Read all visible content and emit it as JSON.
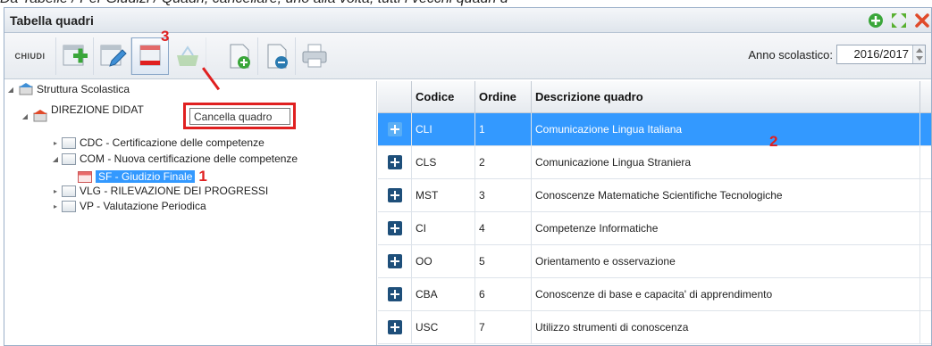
{
  "top_strip": "Da Tabelle / Per Giudizi / Quadri, cancellare, uno alla volta, tutti i vecchi quadri d",
  "window": {
    "title": "Tabella quadri"
  },
  "title_icons": [
    "add-circle-icon",
    "maximize-icon",
    "close-icon"
  ],
  "toolbar": {
    "close_label": "CHIUDI",
    "buttons": [
      "add-quadro-icon",
      "edit-quadro-icon",
      "delete-quadro-icon",
      "basket-icon",
      "add-document-icon",
      "document-settings-icon",
      "print-icon"
    ],
    "annotation": "3",
    "year_label": "Anno scolastico:",
    "year_value": "2016/2017"
  },
  "tooltip": "Cancella quadro",
  "tree": {
    "root": "Struttura Scolastica",
    "school": "DIREZIONE DIDAT",
    "items": [
      "CDC - Certificazione delle competenze",
      "COM - Nuova certificazione delle competenze",
      "SF - Giudizio Finale",
      "VLG - RILEVAZIONE DEI PROGRESSI",
      "VP - Valutazione Periodica"
    ],
    "annotation": "1"
  },
  "grid": {
    "headers": [
      "Codice",
      "Ordine",
      "Descrizione quadro"
    ],
    "annotation": "2",
    "rows": [
      {
        "code": "CLI",
        "order": "1",
        "desc": "Comunicazione Lingua Italiana"
      },
      {
        "code": "CLS",
        "order": "2",
        "desc": "Comunicazione Lingua Straniera"
      },
      {
        "code": "MST",
        "order": "3",
        "desc": "Conoscenze Matematiche Scientifiche Tecnologiche"
      },
      {
        "code": "CI",
        "order": "4",
        "desc": "Competenze Informatiche"
      },
      {
        "code": "OO",
        "order": "5",
        "desc": "Orientamento e osservazione"
      },
      {
        "code": "CBA",
        "order": "6",
        "desc": "Conoscenze di base e capacita' di apprendimento"
      },
      {
        "code": "USC",
        "order": "7",
        "desc": "Utilizzo strumenti di conoscenza"
      }
    ]
  },
  "colors": {
    "selection": "#3399ff",
    "annotation": "#e02020",
    "add_green": "#3aa63a",
    "close_red": "#e04a2a"
  }
}
